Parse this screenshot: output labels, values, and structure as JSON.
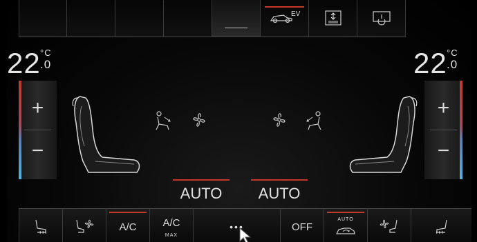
{
  "top_buttons": [
    {
      "id": "blank-1"
    },
    {
      "id": "blank-2"
    },
    {
      "id": "blank-3"
    },
    {
      "id": "blank-4"
    },
    {
      "id": "dash-selected"
    },
    {
      "id": "ev-mode",
      "label": "EV",
      "icon": "car-ev-icon"
    },
    {
      "id": "seat-adjust",
      "icon": "adjust-arrows-icon"
    },
    {
      "id": "power",
      "icon": "screen-power-icon"
    }
  ],
  "left_zone": {
    "temp_whole": "22",
    "temp_unit": "°C",
    "temp_decimal": ".0",
    "plus": "+",
    "minus": "−"
  },
  "right_zone": {
    "temp_whole": "22",
    "temp_unit": "°C",
    "temp_decimal": ".0",
    "plus": "+",
    "minus": "−"
  },
  "center_icons": [
    "person-airflow-icon",
    "fan-icon",
    "fan-icon",
    "person-airflow-icon"
  ],
  "auto": {
    "left": "AUTO",
    "right": "AUTO"
  },
  "bottom_buttons": {
    "ac": "A/C",
    "ac_max_main": "A/C",
    "ac_max_sub": "MAX",
    "more": "•••",
    "off": "OFF",
    "auto_recirc": "AUTO"
  },
  "colors": {
    "accent_red": "#c0392b",
    "cool_blue": "#4fb3e0"
  }
}
